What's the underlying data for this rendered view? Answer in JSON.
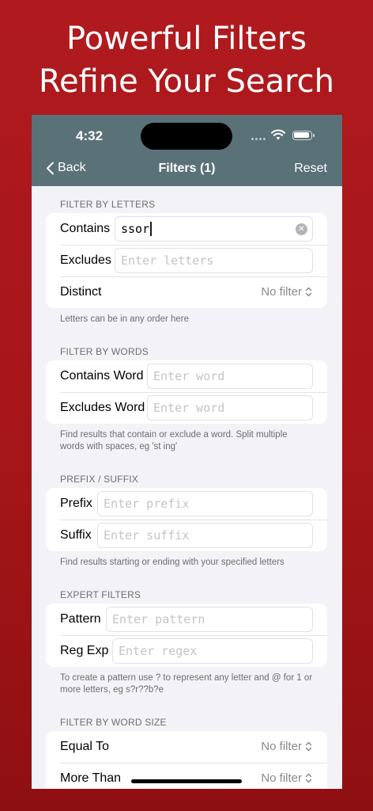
{
  "promo": {
    "line1": "Powerful Filters",
    "line2": "Refine Your Search"
  },
  "status_bar": {
    "time": "4:32"
  },
  "nav": {
    "back_label": "Back",
    "title": "Filters (1)",
    "reset_label": "Reset"
  },
  "letters": {
    "header": "FILTER BY LETTERS",
    "contains_label": "Contains",
    "contains_value": "ssor",
    "excludes_label": "Excludes",
    "excludes_placeholder": "Enter letters",
    "distinct_label": "Distinct",
    "distinct_value": "No filter",
    "footer": "Letters can be in any order here"
  },
  "words": {
    "header": "FILTER BY WORDS",
    "contains_label": "Contains Word",
    "contains_placeholder": "Enter word",
    "excludes_label": "Excludes Word",
    "excludes_placeholder": "Enter word",
    "footer": "Find results that contain or exclude a word. Split multiple words with spaces, eg 'st ing'"
  },
  "prefix_suffix": {
    "header": "PREFIX / SUFFIX",
    "prefix_label": "Prefix",
    "prefix_placeholder": "Enter prefix",
    "suffix_label": "Suffix",
    "suffix_placeholder": "Enter suffix",
    "footer": "Find results starting or ending with your specified letters"
  },
  "expert": {
    "header": "EXPERT FILTERS",
    "pattern_label": "Pattern",
    "pattern_placeholder": "Enter pattern",
    "regex_label": "Reg Exp",
    "regex_placeholder": "Enter regex",
    "footer": "To create a pattern use ? to represent any letter and @ for 1 or more letters, eg s?r??b?e"
  },
  "word_size": {
    "header": "FILTER BY WORD SIZE",
    "equal_label": "Equal To",
    "equal_value": "No filter",
    "more_label": "More Than",
    "more_value": "No filter"
  },
  "colors": {
    "background": "#a51619",
    "nav_bar": "#5b7178",
    "list_background": "#f2f2f7"
  }
}
